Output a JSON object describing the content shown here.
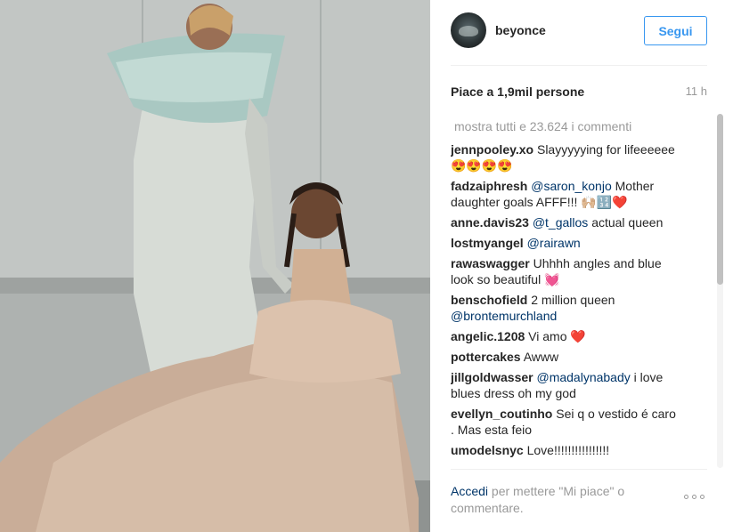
{
  "header": {
    "username": "beyonce",
    "follow_label": "Segui"
  },
  "stats": {
    "likes": "Piace a 1,9mil persone",
    "time": "11 h"
  },
  "comments_section": {
    "show_all": "mostra tutti e 23.624 i commenti",
    "items": [
      {
        "user": "jennpooley.xo",
        "text": "Slayyyyying for lifeeeeee",
        "emoji": "😍😍😍😍"
      },
      {
        "user": "fadzaiphresh",
        "mention": "@saron_konjo",
        "text": "Mother daughter goals AFFF!!!",
        "emoji": "🙌🏼🔢❤️"
      },
      {
        "user": "anne.davis23",
        "mention": "@t_gallos",
        "text": "actual queen"
      },
      {
        "user": "lostmyangel",
        "mention": "@rairawn"
      },
      {
        "user": "rawaswagger",
        "text": "Uhhhh angles and blue look so beautiful",
        "emoji": "💓"
      },
      {
        "user": "benschofield",
        "text": "2 million queen",
        "mention": "@brontemurchland"
      },
      {
        "user": "angelic.1208",
        "text": "Vi amo",
        "emoji": "❤️"
      },
      {
        "user": "pottercakes",
        "text": "Awww"
      },
      {
        "user": "jillgoldwasser",
        "mention": "@madalynabady",
        "text": "i love blues dress oh my god"
      },
      {
        "user": "evellyn_coutinho",
        "text": "Sei q o vestido é caro . Mas esta feio"
      },
      {
        "user": "umodelsnyc",
        "text": "Love!!!!!!!!!!!!!!!!"
      }
    ]
  },
  "footer": {
    "login": "Accedi",
    "rest": "per mettere \"Mi piace\" o commentare."
  },
  "icons": {
    "more": "more-options-icon",
    "avatar": "profile-avatar"
  },
  "colors": {
    "accent": "#3897f0",
    "link": "#003569",
    "muted": "#999999"
  }
}
